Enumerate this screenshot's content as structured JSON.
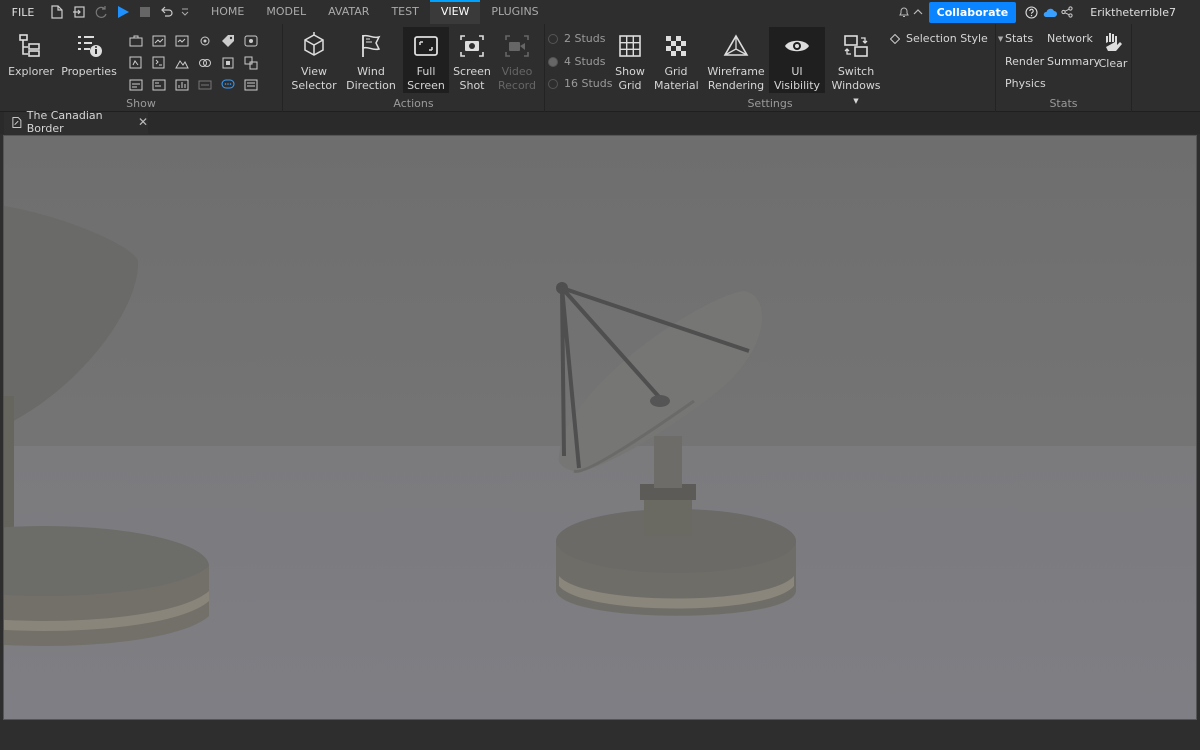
{
  "menubar": {
    "file_label": "FILE",
    "tabs": [
      {
        "label": "HOME"
      },
      {
        "label": "MODEL"
      },
      {
        "label": "AVATAR"
      },
      {
        "label": "TEST"
      },
      {
        "label": "VIEW"
      },
      {
        "label": "PLUGINS"
      }
    ],
    "active_tab": "VIEW",
    "collaborate_label": "Collaborate",
    "username": "Eriktheterrible7"
  },
  "ribbon": {
    "show": {
      "label": "Show",
      "explorer_label": "Explorer",
      "properties_label": "Properties"
    },
    "actions": {
      "label": "Actions",
      "view_selector": "View\nSelector",
      "wind_direction": "Wind\nDirection",
      "full_screen": "Full\nScreen",
      "screen_shot": "Screen\nShot",
      "video_record": "Video\nRecord"
    },
    "settings": {
      "label": "Settings",
      "studs": [
        "2 Studs",
        "4 Studs",
        "16 Studs"
      ],
      "selected_studs": "4 Studs",
      "show_grid": "Show\nGrid",
      "grid_material": "Grid\nMaterial",
      "wireframe": "Wireframe\nRendering",
      "ui_visibility": "UI Visibility",
      "switch_windows": "Switch\nWindows",
      "selection_style": "Selection Style"
    },
    "stats": {
      "label": "Stats",
      "stats": "Stats",
      "network": "Network",
      "render": "Render",
      "summary": "Summary",
      "physics": "Physics",
      "clear": "Clear"
    }
  },
  "document": {
    "tab_title": "The Canadian Border"
  },
  "colors": {
    "accent": "#00a2ff",
    "collaborate": "#0a84ff",
    "play": "#1e90ff"
  }
}
